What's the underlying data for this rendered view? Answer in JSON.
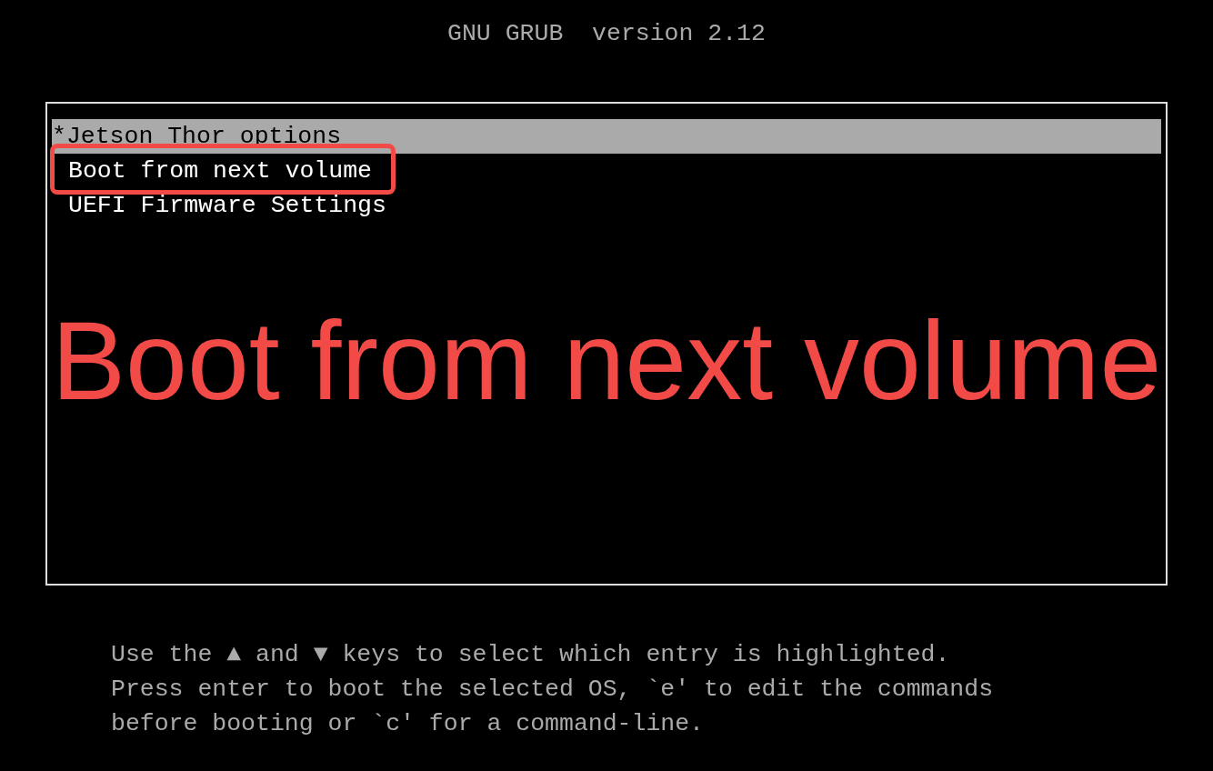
{
  "header": "GNU GRUB  version 2.12",
  "menu": {
    "entries": [
      {
        "label": "*Jetson Thor options",
        "selected": true,
        "annotated": false
      },
      {
        "label": "Boot from next volume",
        "selected": false,
        "annotated": true
      },
      {
        "label": "UEFI Firmware Settings",
        "selected": false,
        "annotated": false
      }
    ]
  },
  "annotation": {
    "caption": "Boot from next volume"
  },
  "help": [
    "Use the ▲ and ▼ keys to select which entry is highlighted.",
    "Press enter to boot the selected OS, `e' to edit the commands",
    "before booting or `c' for a command-line."
  ]
}
